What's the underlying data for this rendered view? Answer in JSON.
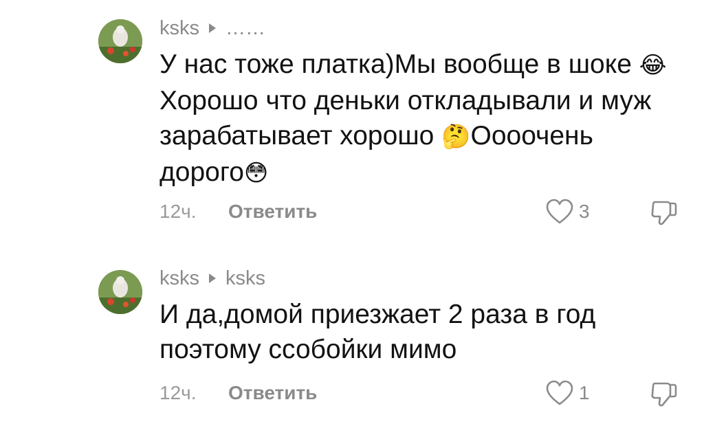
{
  "comments": [
    {
      "author": "ksks",
      "reply_to": "……",
      "text_parts": [
        "У нас тоже платка)Мы вообще в шоке ",
        "😂",
        "Хорошо что деньки откладывали и муж зарабатывает хорошо ",
        "🤔",
        "Оооочень дорого",
        "😳"
      ],
      "time": "12ч.",
      "reply_label": "Ответить",
      "likes": "3"
    },
    {
      "author": "ksks",
      "reply_to": "ksks",
      "text": "И да,домой приезжает 2 раза в год поэтому ссобойки мимо",
      "time": "12ч.",
      "reply_label": "Ответить",
      "likes": "1"
    }
  ],
  "icons": {
    "avatar": "avatar-photo",
    "reply_arrow": "caret-right-icon",
    "like": "heart-outline-icon",
    "dislike": "thumbs-down-outline-icon"
  },
  "colors": {
    "text": "#121212",
    "muted": "#8a8a8a",
    "background": "#ffffff"
  }
}
